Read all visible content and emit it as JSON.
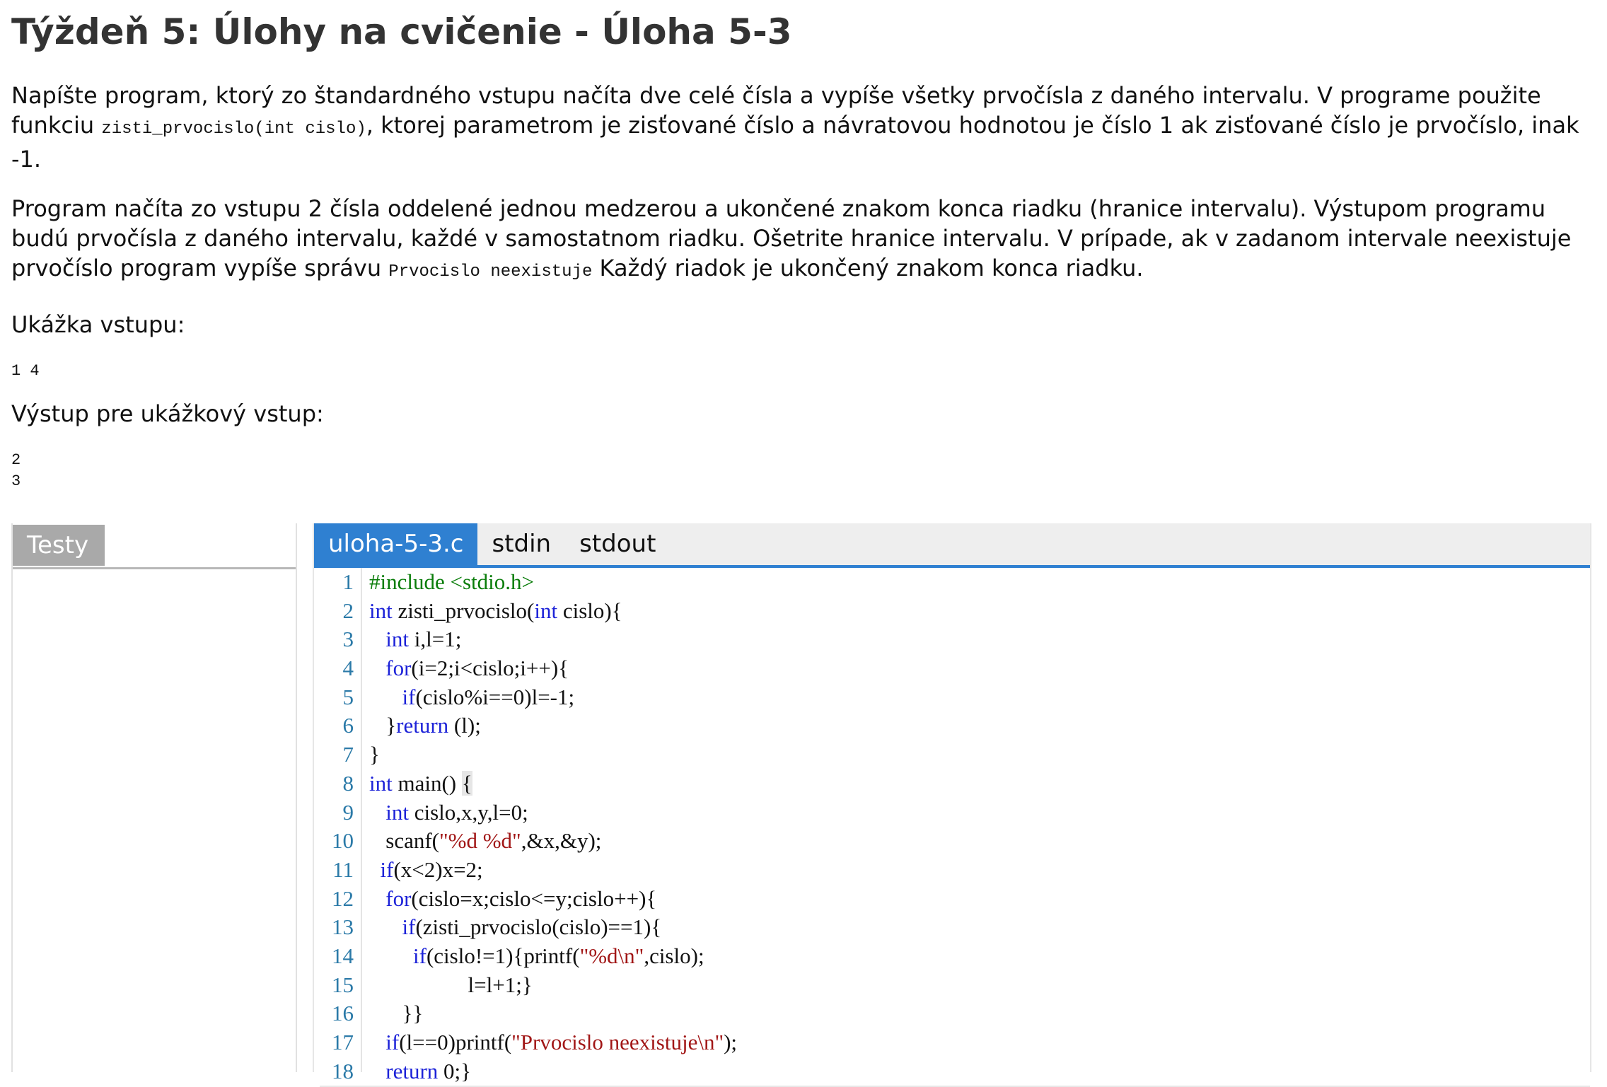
{
  "page": {
    "title": "Týždeň 5: Úlohy na cvičenie - Úloha 5-3"
  },
  "task": {
    "p1_a": "Napíšte program, ktorý zo štandardného vstupu načíta dve celé čísla a vypíše všetky prvočísla z daného intervalu. V programe použite funkciu ",
    "p1_code": "zisti_prvocislo(int cislo)",
    "p1_b": ", ktorej parametrom je zisťované číslo a návratovou hodnotou je číslo 1 ak zisťované číslo je prvočíslo, inak -1.",
    "p2_a": "Program načíta zo vstupu 2 čísla oddelené jednou medzerou a ukončené znakom konca riadku (hranice intervalu). Výstupom programu budú prvočísla z daného intervalu, každé v samostatnom riadku. Ošetrite hranice intervalu. V prípade, ak v zadanom intervale neexistuje prvočíslo program vypíše správu ",
    "p2_code": "Prvocislo neexistuje",
    "p2_b": " Každý riadok je ukončený znakom konca riadku.",
    "sample_input_label": "Ukážka vstupu:",
    "sample_input": "1 4",
    "sample_output_label": "Výstup pre ukážkový vstup:",
    "sample_output": "2\n3"
  },
  "tests_panel": {
    "tab_label": "Testy"
  },
  "editor": {
    "tabs": [
      "uloha-5-3.c",
      "stdin",
      "stdout"
    ],
    "active_tab": "uloha-5-3.c",
    "line_numbers": [
      "1",
      "2",
      "3",
      "4",
      "5",
      "6",
      "7",
      "8",
      "9",
      "10",
      "11",
      "12",
      "13",
      "14",
      "15",
      "16",
      "17",
      "18"
    ],
    "code_lines": [
      "#include <stdio.h>",
      "int zisti_prvocislo(int cislo){",
      "   int i,l=1;",
      "   for(i=2;i<cislo;i++){",
      "      if(cislo%i==0)l=-1;",
      "   }return (l);",
      "}",
      "int main() {",
      "   int cislo,x,y,l=0;",
      "   scanf(\"%d %d\",&x,&y);",
      "  if(x<2)x=2;",
      "   for(cislo=x;cislo<=y;cislo++){",
      "      if(zisti_prvocislo(cislo)==1){",
      "        if(cislo!=1){printf(\"%d\\n\",cislo);",
      "                  l=l+1;}",
      "      }}",
      "   if(l==0)printf(\"Prvocislo neexistuje\\n\");",
      "   return 0;}"
    ]
  }
}
